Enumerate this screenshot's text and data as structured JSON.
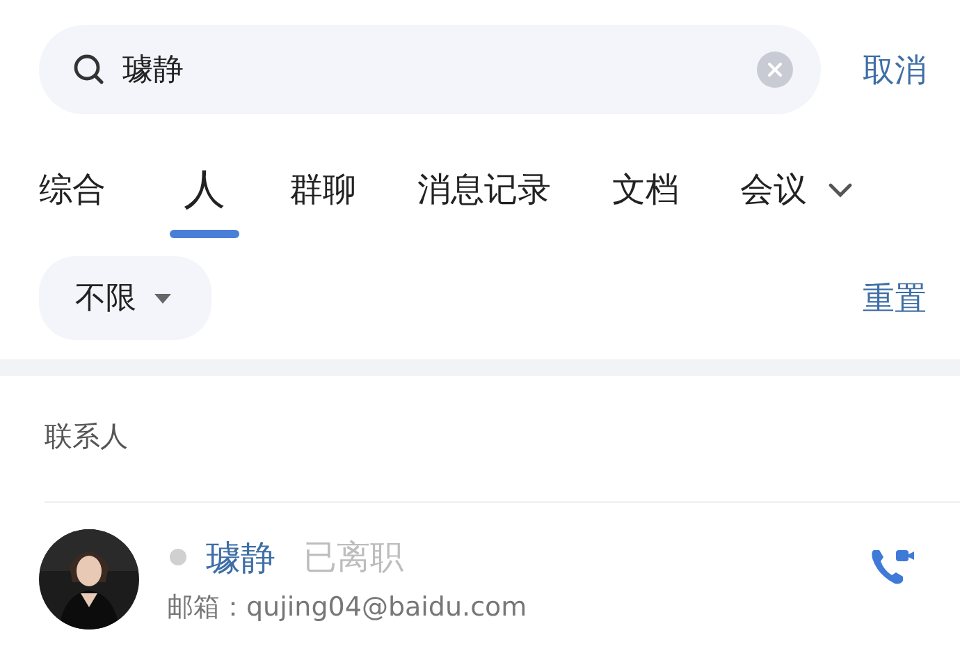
{
  "search": {
    "value": "璩静",
    "cancel": "取消"
  },
  "tabs": [
    {
      "label": "综合",
      "selected": false
    },
    {
      "label": "人",
      "selected": true
    },
    {
      "label": "群聊",
      "selected": false
    },
    {
      "label": "消息记录",
      "selected": false
    },
    {
      "label": "文档",
      "selected": false
    },
    {
      "label": "会议",
      "selected": false
    }
  ],
  "filter": {
    "label": "不限",
    "reset": "重置"
  },
  "section": {
    "title": "联系人"
  },
  "contacts": [
    {
      "name": "璩静",
      "status": "已离职",
      "email_label": "邮箱：",
      "email": "qujing04@baidu.com"
    }
  ]
}
